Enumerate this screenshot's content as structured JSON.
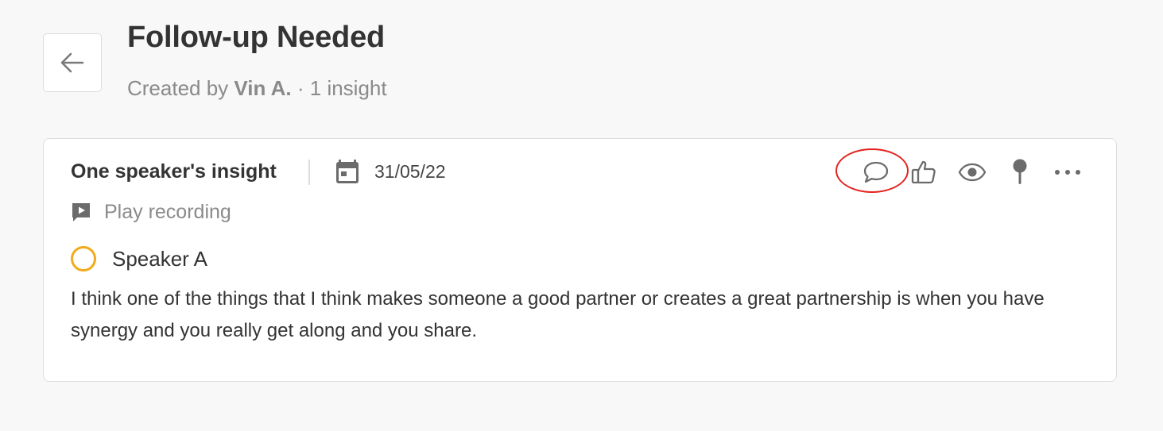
{
  "header": {
    "back_icon": "arrow-left-icon",
    "title": "Follow-up Needed",
    "created_by_prefix": "Created by ",
    "author": "Vin A.",
    "separator": " · ",
    "insight_count": "1 insight"
  },
  "insight": {
    "type": "One speaker's insight",
    "date_icon": "calendar-icon",
    "date": "31/05/22",
    "play_recording_icon": "video-comment-icon",
    "play_recording_label": "Play recording",
    "speaker": {
      "name": "Speaker A",
      "avatar_color": "#f2aa1c"
    },
    "transcript": "I think one of the things that I think makes someone a good partner or creates a great partnership is when you have synergy and you really get along and you share.",
    "actions": [
      {
        "icon": "comment-icon"
      },
      {
        "icon": "thumbs-up-icon"
      },
      {
        "icon": "eye-icon"
      },
      {
        "icon": "pin-icon"
      },
      {
        "icon": "more-icon"
      }
    ],
    "highlight_color": "#e3221e"
  }
}
